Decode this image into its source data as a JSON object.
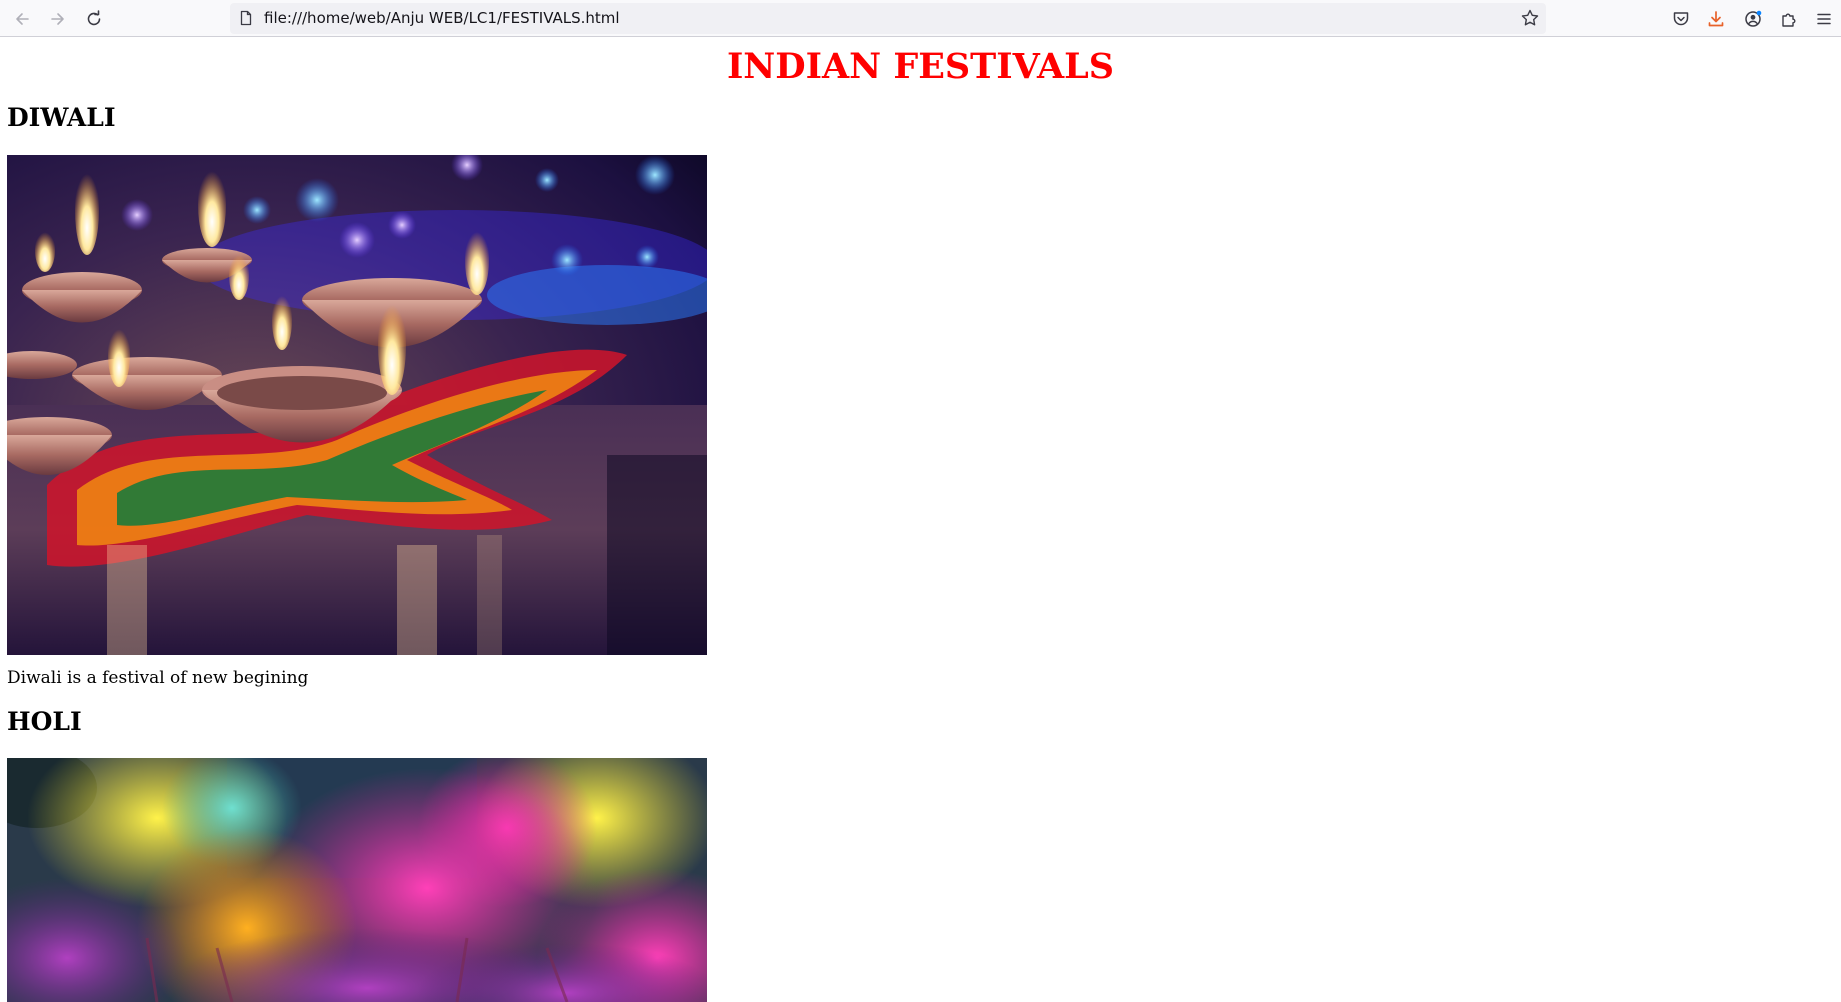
{
  "browser": {
    "url": "file:///home/web/Anju WEB/LC1/FESTIVALS.html"
  },
  "page": {
    "title": "INDIAN FESTIVALS",
    "sections": [
      {
        "heading": "DIWALI",
        "image_alt": "Diwali lamps",
        "caption": "Diwali is a festival of new begining"
      },
      {
        "heading": "HOLI",
        "image_alt": "Holi colors"
      }
    ]
  },
  "colors": {
    "title": "#ff0000",
    "toolbar_bg": "#f9f9fb",
    "urlbar_bg": "#f0f0f4"
  }
}
